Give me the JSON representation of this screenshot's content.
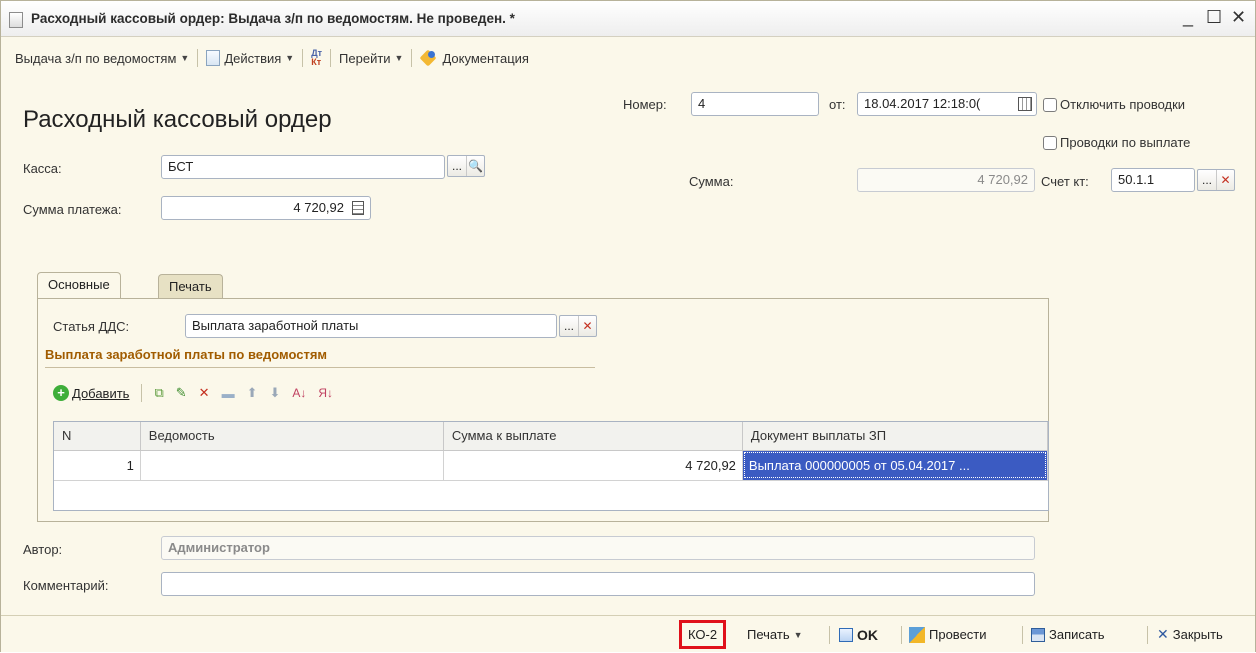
{
  "window": {
    "title": "Расходный кассовый ордер: Выдача з/п по ведомостям. Не проведен. *",
    "minimize_glyph": "_",
    "maximize_glyph": "☐",
    "close_glyph": "✕"
  },
  "toolbar": {
    "operation_label": "Выдача з/п по ведомостям",
    "actions_label": "Действия",
    "dtkt_top": "Дт",
    "dtkt_bottom": "Кт",
    "goto_label": "Перейти",
    "documentation_label": "Документация"
  },
  "form": {
    "title": "Расходный кассовый ордер",
    "number_label": "Номер:",
    "number_value": "4",
    "date_label": "от:",
    "date_value": "18.04.2017 12:18:0(",
    "disable_postings_label": "Отключить проводки",
    "payment_postings_label": "Проводки по выплате",
    "kassa_label": "Касса:",
    "kassa_value": "БСТ",
    "summa_label": "Сумма:",
    "summa_value": "4 720,92",
    "account_label": "Счет кт:",
    "account_value": "50.1.1",
    "payment_sum_label": "Сумма платежа:",
    "payment_sum_value": "4 720,92"
  },
  "tabs": [
    {
      "label": "Основные",
      "active": true
    },
    {
      "label": "Печать",
      "active": false
    }
  ],
  "main_tab": {
    "dds_label": "Статья ДДС:",
    "dds_value": "Выплата заработной платы",
    "section_title": "Выплата заработной платы по ведомостям",
    "add_label": "Добавить",
    "columns": [
      "N",
      "Ведомость",
      "Сумма к выплате",
      "Документ выплаты ЗП"
    ],
    "rows": [
      {
        "n": "1",
        "vedomost": "",
        "summa": "4 720,92",
        "document": "Выплата 000000005 от 05.04.2017 ..."
      }
    ]
  },
  "footer": {
    "author_label": "Автор:",
    "author_value": "Администратор",
    "comment_label": "Комментарий:",
    "comment_value": ""
  },
  "bottombar": {
    "ko2_label": "КО-2",
    "print_label": "Печать",
    "ok_label": "OK",
    "post_label": "Провести",
    "save_label": "Записать",
    "close_label": "Закрыть"
  },
  "colors": {
    "highlight_box": "#e0101a",
    "selection": "#3b5bc2",
    "section_title": "#a15c00",
    "window_bg": "#fbf8ea"
  }
}
